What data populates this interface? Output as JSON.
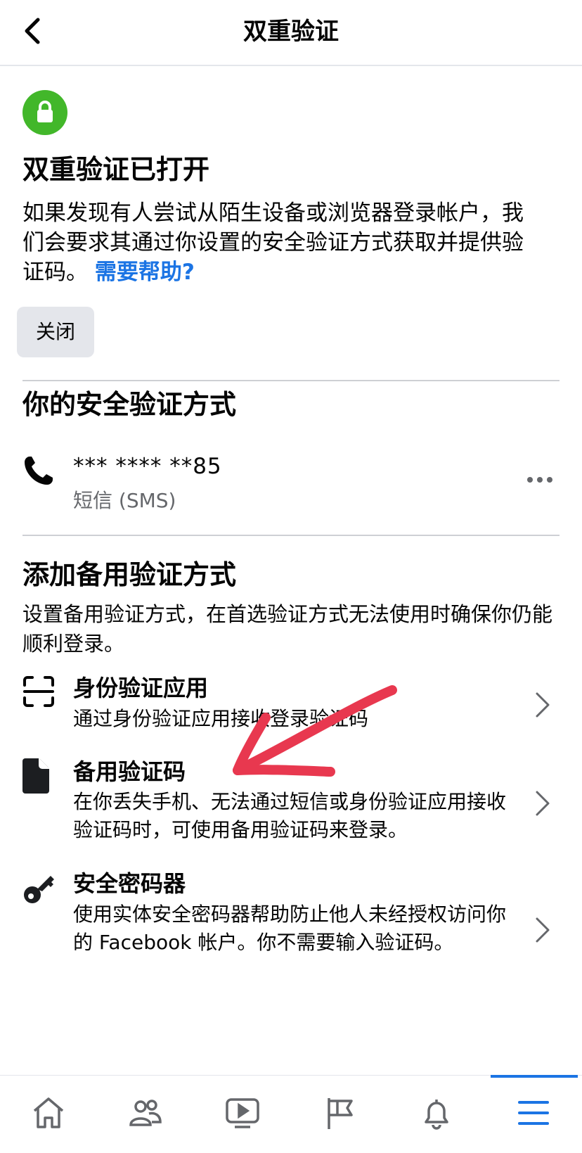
{
  "header": {
    "title": "双重验证"
  },
  "status": {
    "heading": "双重验证已打开",
    "description": "如果发现有人尝试从陌生设备或浏览器登录帐户，我们会要求其通过你设置的安全验证方式获取并提供验证码。",
    "help_link": "需要帮助?",
    "close_button": "关闭"
  },
  "methods": {
    "heading": "你的安全验证方式",
    "phone_masked": "*** **** **85",
    "phone_type": "短信 (SMS)"
  },
  "backup": {
    "heading": "添加备用验证方式",
    "description": "设置备用验证方式，在首选验证方式无法使用时确保你仍能顺利登录。",
    "options": [
      {
        "title": "身份验证应用",
        "desc": "通过身份验证应用接收登录验证码",
        "icon": "qr-scan-icon"
      },
      {
        "title": "备用验证码",
        "desc": "在你丢失手机、无法通过短信或身份验证应用接收验证码时，可使用备用验证码来登录。",
        "icon": "document-icon"
      },
      {
        "title": "安全密码器",
        "desc": "使用实体安全密码器帮助防止他人未经授权访问你的 Facebook 帐户。你不需要输入验证码。",
        "icon": "key-icon"
      }
    ]
  },
  "tabbar": {
    "items": [
      "home-icon",
      "friends-icon",
      "video-icon",
      "pages-flag-icon",
      "notifications-bell-icon",
      "menu-icon"
    ],
    "active": "menu-icon"
  },
  "colors": {
    "accent": "#1b74e4",
    "success": "#42b72a",
    "annotation": "#e8384f"
  }
}
